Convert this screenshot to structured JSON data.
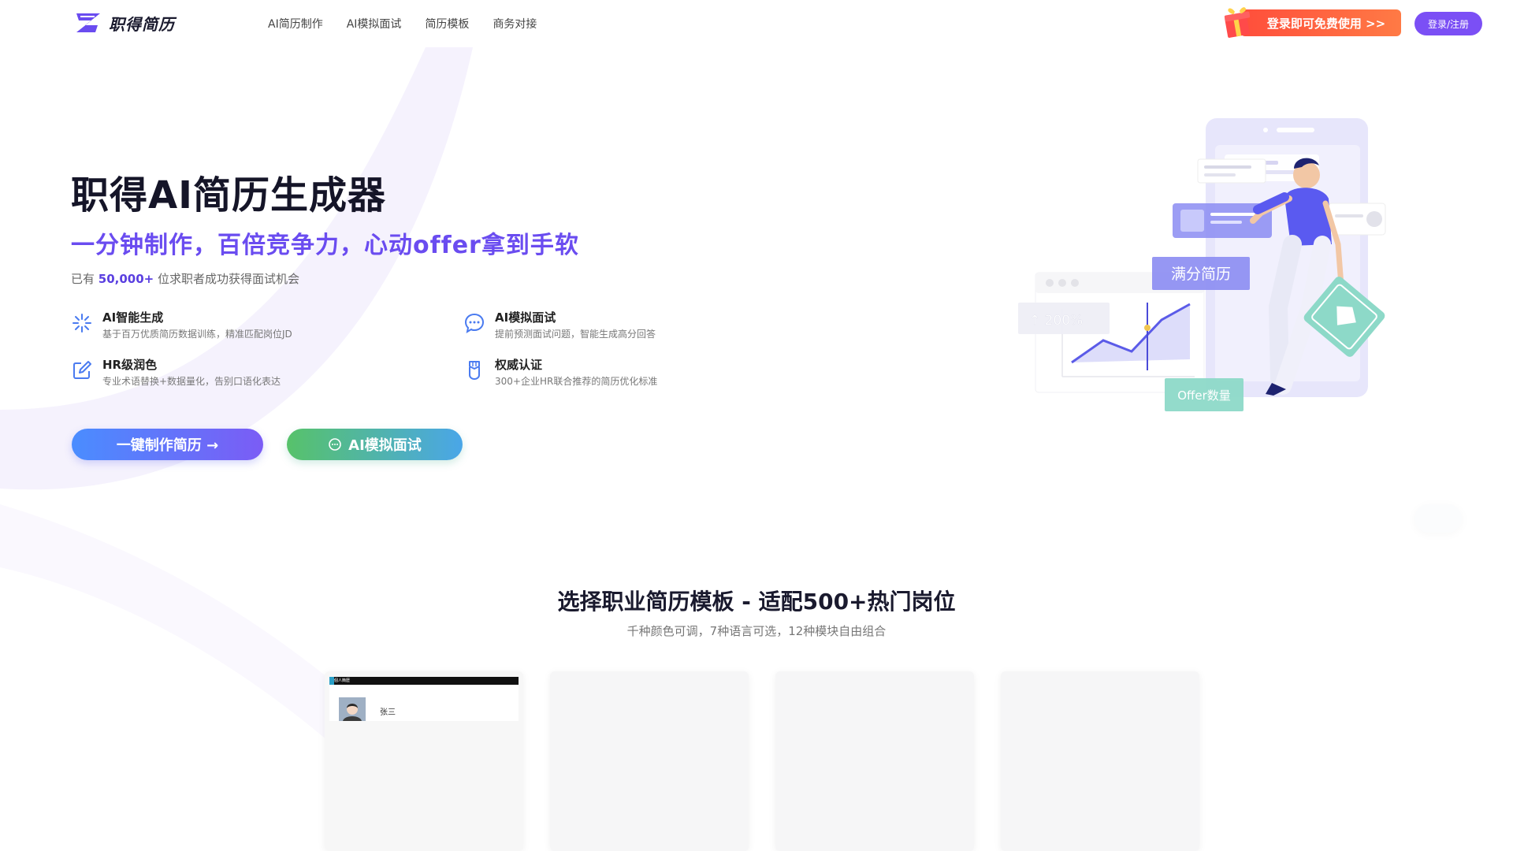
{
  "header": {
    "logo_text": "职得简历",
    "nav": [
      "AI简历制作",
      "AI模拟面试",
      "简历模板",
      "商务对接"
    ],
    "promo_label": "登录即可免费使用 >>",
    "login_label": "登录/注册"
  },
  "hero": {
    "title": "职得AI简历生成器",
    "subtitle": "一分钟制作，百倍竞争力，心动offer拿到手软",
    "stat_prefix": "已有",
    "stat_number": "50,000+",
    "stat_suffix": "位求职者成功获得面试机会",
    "features": [
      {
        "title": "AI智能生成",
        "desc": "基于百万优质简历数据训练，精准匹配岗位JD",
        "icon": "sparkle-icon"
      },
      {
        "title": "AI模拟面试",
        "desc": "提前预测面试问题，智能生成高分回答",
        "icon": "chat-bubble-icon"
      },
      {
        "title": "HR级润色",
        "desc": "专业术语替换+数据量化，告别口语化表达",
        "icon": "edit-icon"
      },
      {
        "title": "权威认证",
        "desc": "300+企业HR联合推荐的简历优化标准",
        "icon": "medal-icon"
      }
    ],
    "cta_primary": "一键制作简历 →",
    "cta_secondary": "AI模拟面试"
  },
  "illustration": {
    "label_full_score": "满分简历",
    "label_growth": "200%",
    "label_offer": "Offer数量"
  },
  "templates": {
    "title": "选择职业简历模板 - 适配500+热门岗位",
    "subtitle": "千种颜色可调，7种语言可选，12种模块自由组合",
    "card1_bar_label": "個人簡歷",
    "card1_name": "张三"
  },
  "colors": {
    "brand_purple": "#6a4cf0",
    "promo_orange": "#ff5a3c",
    "login_purple": "#7b4ff5"
  }
}
